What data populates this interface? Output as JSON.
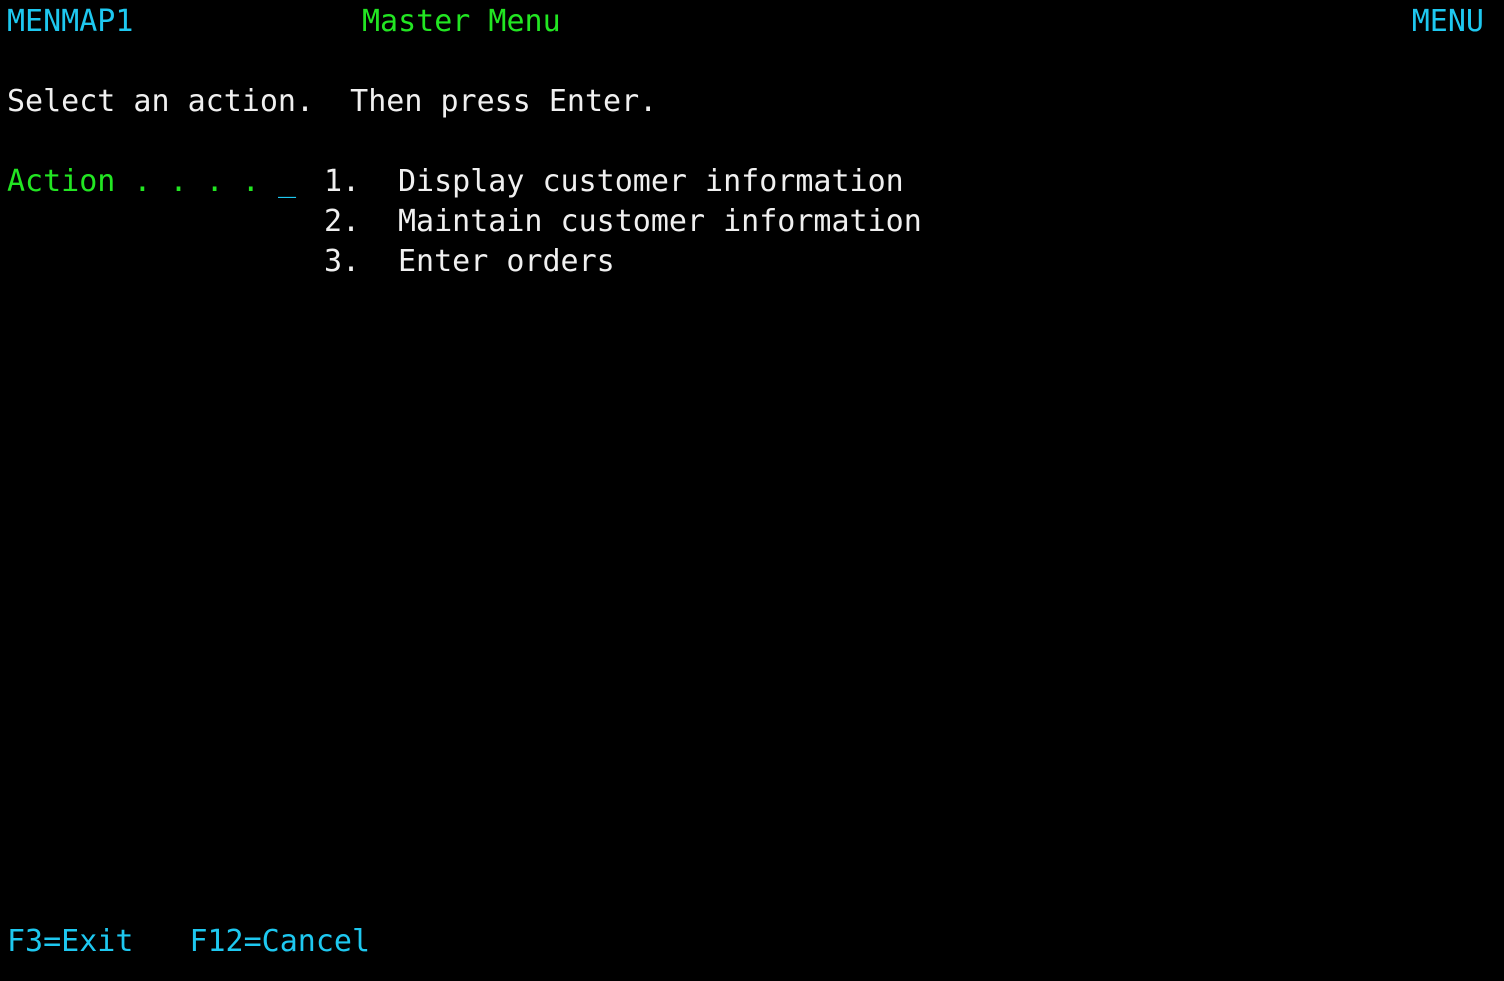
{
  "header": {
    "program_id": "MENMAP1",
    "title": "Master Menu",
    "screen_id": "MENU"
  },
  "instructions": "Select an action.  Then press Enter.",
  "action": {
    "label": "Action . . . .",
    "input_value": "_"
  },
  "options": [
    {
      "number": "1.",
      "label": "Display customer information"
    },
    {
      "number": "2.",
      "label": "Maintain customer information"
    },
    {
      "number": "3.",
      "label": "Enter orders"
    }
  ],
  "function_keys": [
    {
      "label": "F3=Exit"
    },
    {
      "label": "F12=Cancel"
    }
  ],
  "colors": {
    "background": "#000000",
    "cyan": "#1ec8f0",
    "green": "#22e622",
    "white": "#f0f0f0"
  }
}
